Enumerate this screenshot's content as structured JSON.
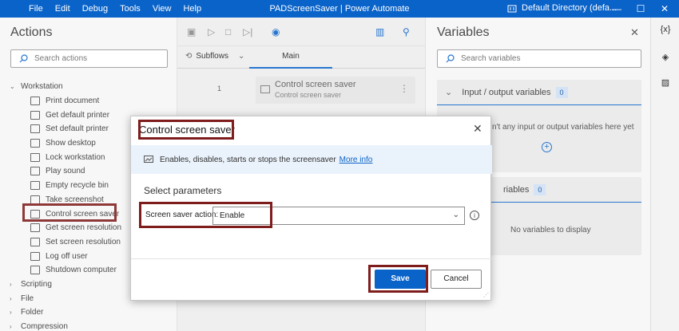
{
  "titlebar": {
    "menu": [
      "File",
      "Edit",
      "Debug",
      "Tools",
      "View",
      "Help"
    ],
    "app_title": "PADScreenSaver | Power Automate",
    "directory": "Default Directory (defa..."
  },
  "actions_pane": {
    "title": "Actions",
    "search_placeholder": "Search actions",
    "groups": [
      {
        "label": "Workstation",
        "expanded": true
      },
      {
        "label": "Scripting",
        "expanded": false
      },
      {
        "label": "File",
        "expanded": false
      },
      {
        "label": "Folder",
        "expanded": false
      },
      {
        "label": "Compression",
        "expanded": false
      }
    ],
    "workstation_items": [
      "Print document",
      "Get default printer",
      "Set default printer",
      "Show desktop",
      "Lock workstation",
      "Play sound",
      "Empty recycle bin",
      "Take screenshot",
      "Control screen saver",
      "Get screen resolution",
      "Set screen resolution",
      "Log off user",
      "Shutdown computer"
    ]
  },
  "designer": {
    "tab_subflows": "Subflows",
    "tab_main": "Main",
    "step_number": "1",
    "step_title": "Control screen saver",
    "step_subtitle": "Control screen saver"
  },
  "variables_pane": {
    "title": "Variables",
    "search_placeholder": "Search variables",
    "io_section": {
      "label": "Input / output variables",
      "count": "0",
      "empty_text": "n't any input or output variables here yet"
    },
    "flow_section": {
      "label": "riables",
      "count": "0",
      "empty_text": "No variables to display"
    }
  },
  "rail": {
    "icon1": "{x}"
  },
  "dialog": {
    "title": "Control screen saver",
    "info_text": "Enables, disables, starts or stops the screensaver",
    "info_link": "More info",
    "section": "Select parameters",
    "field_label": "Screen saver action:",
    "field_value": "Enable",
    "save_label": "Save",
    "cancel_label": "Cancel"
  },
  "colors": {
    "accent": "#0a63c9",
    "highlight": "#7f1d1d"
  }
}
